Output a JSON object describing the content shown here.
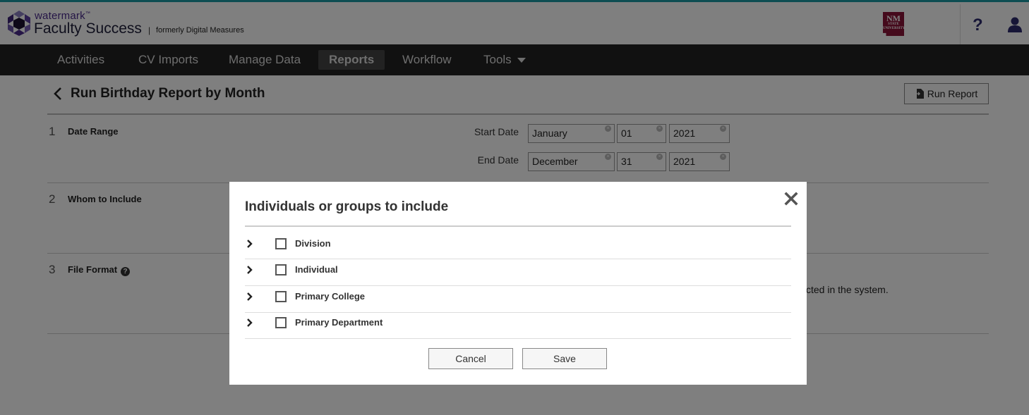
{
  "header": {
    "brand_top": "watermark",
    "brand_tm": "™",
    "brand_main": "Faculty Success",
    "brand_separator": "|",
    "brand_sub": "formerly Digital Measures",
    "institution_logo_line1": "NM",
    "institution_logo_line2": "STATE",
    "institution_logo_line3": "UNIVERSITY",
    "help_label": "?",
    "colors": {
      "top_stripe": "#1a9aa5",
      "brand_purple": "#4a2b8c",
      "institution_maroon": "#8a1538"
    }
  },
  "nav": {
    "items": [
      {
        "label": "Activities",
        "active": false
      },
      {
        "label": "CV Imports",
        "active": false
      },
      {
        "label": "Manage Data",
        "active": false
      },
      {
        "label": "Reports",
        "active": true
      },
      {
        "label": "Workflow",
        "active": false
      },
      {
        "label": "Tools",
        "active": false,
        "has_dropdown": true
      }
    ]
  },
  "page": {
    "title": "Run Birthday Report by Month",
    "run_report_label": "Run Report",
    "sections": [
      {
        "number": "1",
        "label": "Date Range"
      },
      {
        "number": "2",
        "label": "Whom to Include"
      },
      {
        "number": "3",
        "label": "File Format",
        "has_info_icon": true
      }
    ],
    "date_range": {
      "start_label": "Start Date",
      "start_month": "January",
      "start_day": "01",
      "start_year": "2021",
      "end_label": "End Date",
      "end_month": "December",
      "end_day": "31",
      "end_year": "2021",
      "clear_glyph": "×"
    },
    "file_format_hint_partial": "cted in the system."
  },
  "modal": {
    "title": "Individuals or groups to include",
    "close_glyph": "✕",
    "items": [
      {
        "label": "Division",
        "checked": false
      },
      {
        "label": "Individual",
        "checked": false
      },
      {
        "label": "Primary College",
        "checked": false
      },
      {
        "label": "Primary Department",
        "checked": false
      }
    ],
    "cancel_label": "Cancel",
    "save_label": "Save"
  }
}
